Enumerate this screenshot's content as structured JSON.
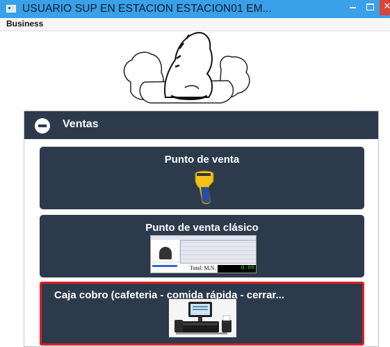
{
  "window": {
    "title": "USUARIO SUP EN ESTACION ESTACION01     EM...",
    "minimize_icon": "minimize-icon",
    "maximize_icon": "maximize-icon",
    "close_label": "✕"
  },
  "menu": {
    "items": [
      "Business"
    ]
  },
  "logo": {
    "icon": "chess-knight-logo"
  },
  "panel": {
    "title": "Ventas",
    "collapse_icon": "minus-circle-icon",
    "tiles": [
      {
        "label": "Punto de venta",
        "icon": "barcode-scanner-icon"
      },
      {
        "label": "Punto de venta clásico",
        "icon": "pos-screenshot-thumbnail",
        "thumb_total_label": "Total: M.N.",
        "thumb_total_value": "0.00"
      },
      {
        "label": "Caja cobro (cafeteria - comida rápida - cerrar...",
        "icon": "cash-register-icon",
        "selected": true
      }
    ]
  },
  "colors": {
    "titlebar": "#3aa0e8",
    "panel": "#2c3a4c",
    "selected_border": "#e02020",
    "close": "#d9453a"
  }
}
